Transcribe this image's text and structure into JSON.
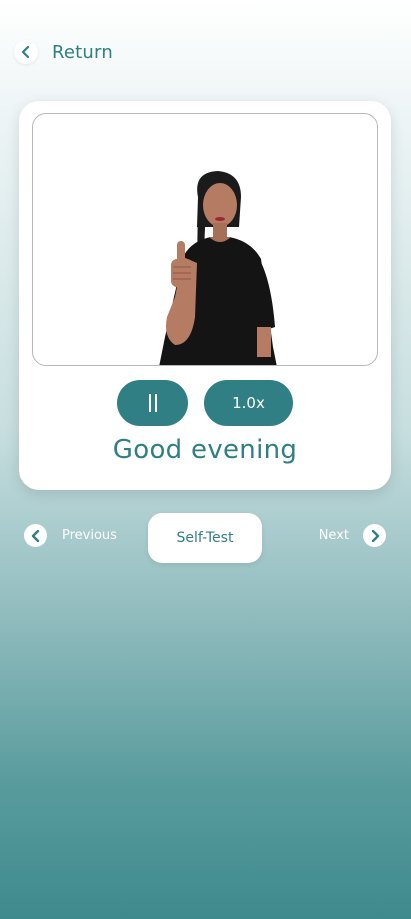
{
  "header": {
    "back_label": "Return"
  },
  "player": {
    "speed_label": "1.0x",
    "phrase": "Good evening"
  },
  "nav": {
    "previous_label": "Previous",
    "self_test_label": "Self-Test",
    "next_label": "Next"
  },
  "colors": {
    "accent": "#2f7f84",
    "card": "#ffffff",
    "background_bottom": "#3e8a8d"
  },
  "icons": {
    "back": "chevron-left-icon",
    "pause": "pause-icon",
    "previous": "chevron-left-icon",
    "next": "chevron-right-icon"
  }
}
